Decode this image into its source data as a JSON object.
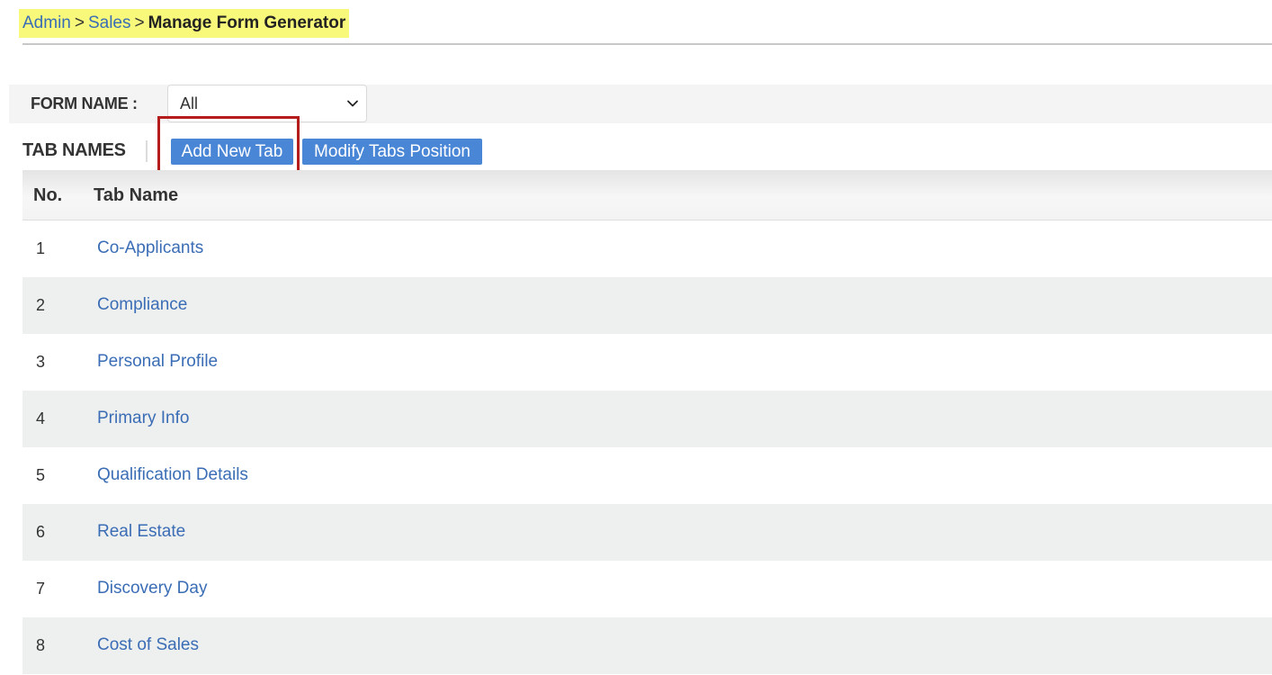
{
  "breadcrumb": {
    "items": [
      "Admin",
      "Sales"
    ],
    "separator": ">",
    "current": "Manage Form Generator"
  },
  "form_filter": {
    "label": "FORM NAME :",
    "selected": "All"
  },
  "toolbar": {
    "heading": "TAB NAMES",
    "add_label": "Add New Tab",
    "modify_label": "Modify Tabs Position"
  },
  "table": {
    "headers": {
      "no": "No.",
      "name": "Tab Name"
    },
    "rows": [
      {
        "no": "1",
        "name": "Co-Applicants"
      },
      {
        "no": "2",
        "name": "Compliance"
      },
      {
        "no": "3",
        "name": "Personal Profile"
      },
      {
        "no": "4",
        "name": "Primary Info"
      },
      {
        "no": "5",
        "name": "Qualification Details"
      },
      {
        "no": "6",
        "name": "Real Estate"
      },
      {
        "no": "7",
        "name": "Discovery Day"
      },
      {
        "no": "8",
        "name": "Cost of Sales"
      }
    ]
  },
  "colors": {
    "link": "#3a6db5",
    "button": "#4a86d6",
    "breadcrumb_highlight": "#f8f97a",
    "annotation_box": "#b51d1d",
    "row_alt": "#eeefef"
  },
  "icons": {
    "select_chevron": "chevron-down-icon"
  }
}
